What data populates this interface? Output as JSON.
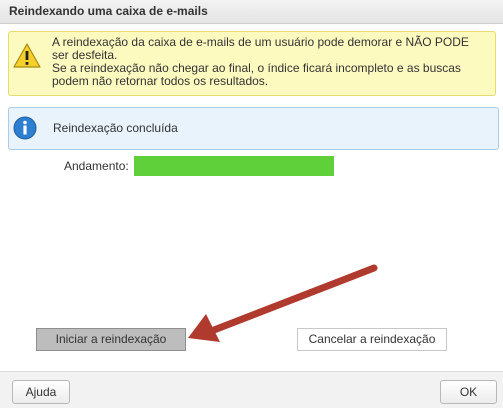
{
  "dialog": {
    "title": "Reindexando uma caixa de e-mails"
  },
  "warning": {
    "icon": "warning-icon",
    "lines": [
      "A reindexação da caixa de e-mails de um usuário pode demorar e NÃO PODE ser desfeita.",
      "Se a reindexação não chegar ao final, o índice ficará incompleto e as buscas podem não retornar todos os resultados."
    ]
  },
  "info": {
    "icon": "info-icon",
    "text": "Reindexação concluída"
  },
  "progress": {
    "label": "Andamento:",
    "value": 1.0,
    "color": "#5fcf3a"
  },
  "actions": {
    "start_label": "Iniciar a reindexação",
    "cancel_label": "Cancelar a reindexação"
  },
  "annotation": {
    "arrow_color": "#b03a2e"
  },
  "footer": {
    "help_label": "Ajuda",
    "ok_label": "OK"
  }
}
